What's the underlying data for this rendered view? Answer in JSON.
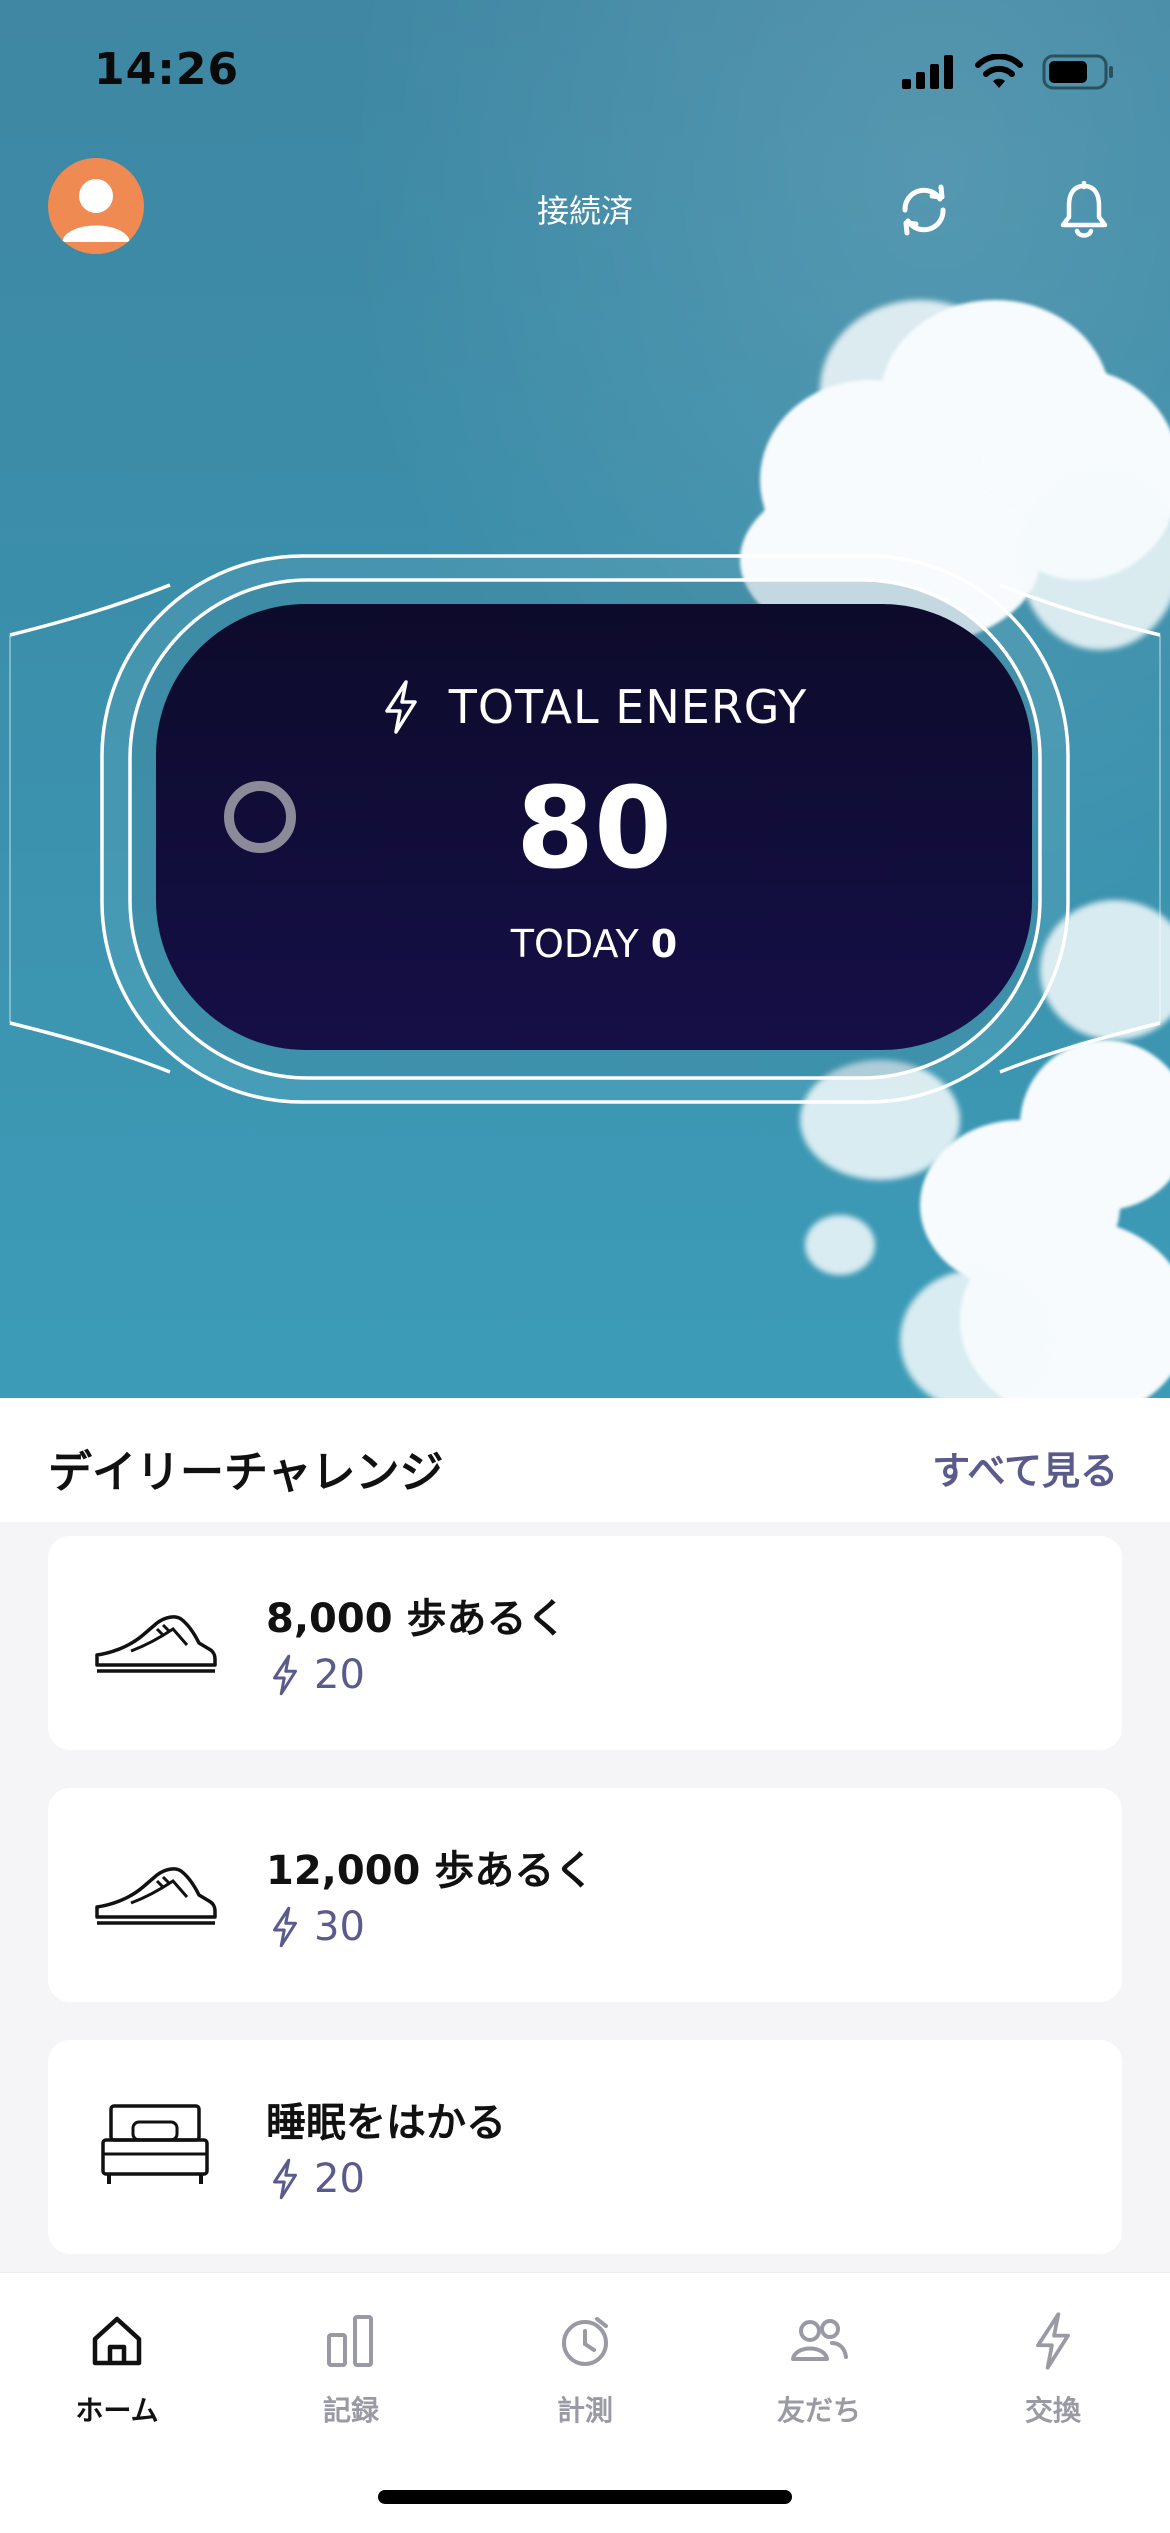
{
  "status_bar": {
    "time": "14:26",
    "icons": [
      "signal-icon",
      "wifi-icon",
      "battery-icon"
    ]
  },
  "header": {
    "connection_status": "接続済",
    "avatar_color": "#ef8a52",
    "icons": [
      "sync-icon",
      "bell-icon"
    ]
  },
  "energy": {
    "label": "TOTAL ENERGY",
    "total": "80",
    "today_label": "TODAY",
    "today_value": "0",
    "icon": "lightning-icon"
  },
  "challenges": {
    "title": "デイリーチャレンジ",
    "see_all": "すべて見る",
    "accent_color": "#5b5a8c",
    "items": [
      {
        "icon": "sneaker-icon",
        "title": "8,000 歩あるく",
        "reward": "20"
      },
      {
        "icon": "sneaker-icon",
        "title": "12,000 歩あるく",
        "reward": "30"
      },
      {
        "icon": "bed-icon",
        "title": "睡眠をはかる",
        "reward": "20"
      }
    ]
  },
  "tabs": [
    {
      "label": "ホーム",
      "icon": "home-icon",
      "active": true
    },
    {
      "label": "記録",
      "icon": "bar-chart-icon",
      "active": false
    },
    {
      "label": "計測",
      "icon": "timer-icon",
      "active": false
    },
    {
      "label": "友だち",
      "icon": "friends-icon",
      "active": false
    },
    {
      "label": "交換",
      "icon": "lightning-icon",
      "active": false
    }
  ]
}
